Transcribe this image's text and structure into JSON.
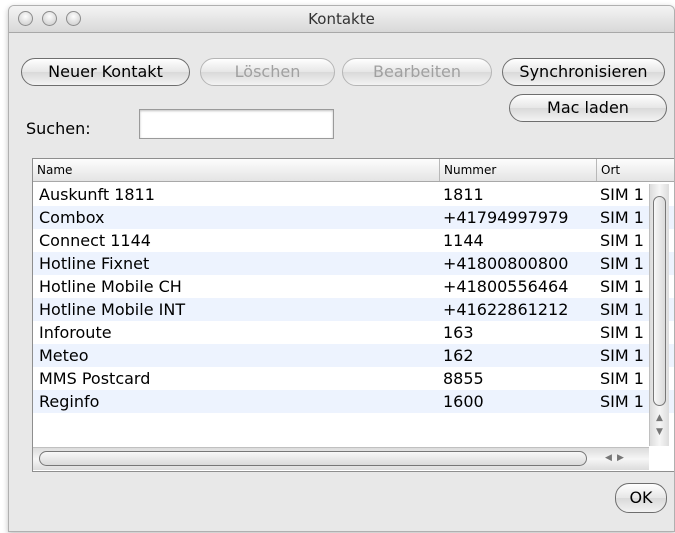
{
  "window": {
    "title": "Kontakte"
  },
  "toolbar": {
    "new_contact": "Neuer Kontakt",
    "delete": "Löschen",
    "edit": "Bearbeiten",
    "sync": "Synchronisieren",
    "mac_load": "Mac laden"
  },
  "search": {
    "label": "Suchen:",
    "value": ""
  },
  "table": {
    "columns": [
      "Name",
      "Nummer",
      "Ort"
    ],
    "rows": [
      [
        "Auskunft 1811",
        "1811",
        "SIM 1"
      ],
      [
        "Combox",
        "+41794997979",
        "SIM 1"
      ],
      [
        "Connect 1144",
        "1144",
        "SIM 1"
      ],
      [
        "Hotline Fixnet",
        "+41800800800",
        "SIM 1"
      ],
      [
        "Hotline Mobile CH",
        "+41800556464",
        "SIM 1"
      ],
      [
        "Hotline Mobile INT",
        "+41622861212",
        "SIM 1"
      ],
      [
        "Inforoute",
        "163",
        "SIM 1"
      ],
      [
        "Meteo",
        "162",
        "SIM 1"
      ],
      [
        "MMS Postcard",
        "8855",
        "SIM 1"
      ],
      [
        "Reginfo",
        "1600",
        "SIM 1"
      ]
    ]
  },
  "footer": {
    "ok": "OK"
  }
}
